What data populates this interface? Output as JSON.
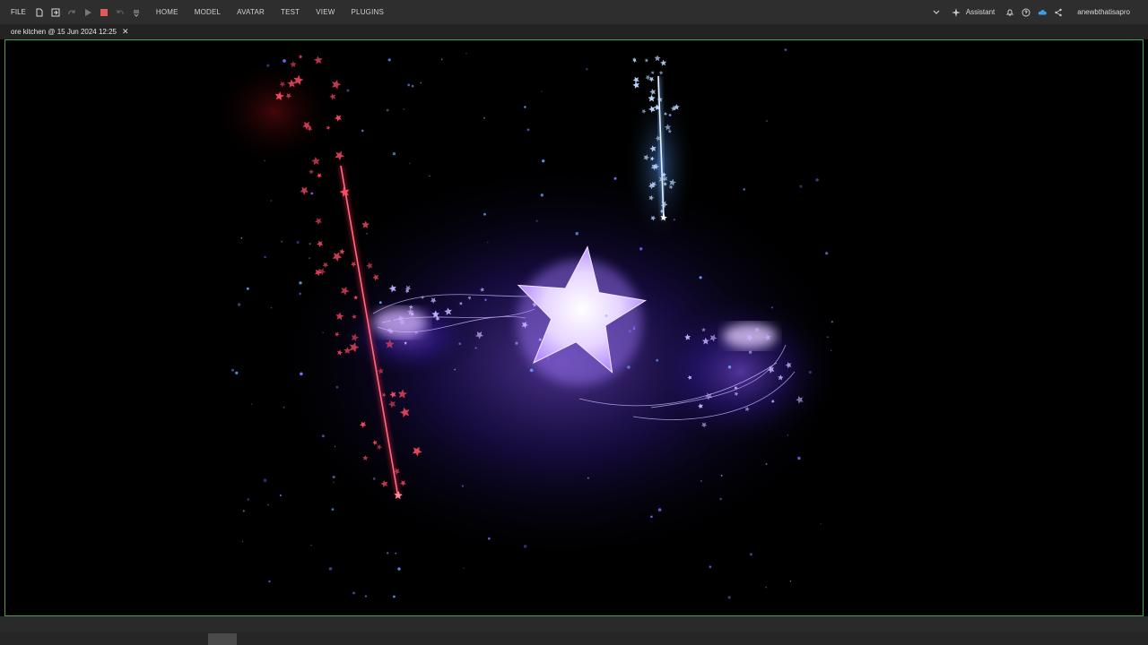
{
  "toolbar": {
    "file_label": "FILE",
    "menus": [
      "HOME",
      "MODEL",
      "AVATAR",
      "TEST",
      "VIEW",
      "PLUGINS"
    ],
    "assistant_label": "Assistant",
    "username": "anewbthatisapro"
  },
  "tabs": [
    {
      "label": "ore kitchen @ 15 Jun 2024 12:25"
    }
  ],
  "icons": {
    "new_file": "new-file-icon",
    "import": "import-icon",
    "redo": "redo-icon",
    "play": "play-icon",
    "stop": "stop-icon",
    "undo": "undo-icon",
    "more": "more-icon",
    "dropdown": "chevron-down-icon",
    "assistant": "sparkle-icon",
    "notifications": "bell-icon",
    "help": "help-icon",
    "cloud": "cloud-icon",
    "share": "share-icon"
  },
  "colors": {
    "toolbar_bg": "#2e2e2e",
    "viewport_border": "#3ba35a",
    "stop_red": "#e05a5a",
    "cloud_blue": "#3aa0e0"
  }
}
